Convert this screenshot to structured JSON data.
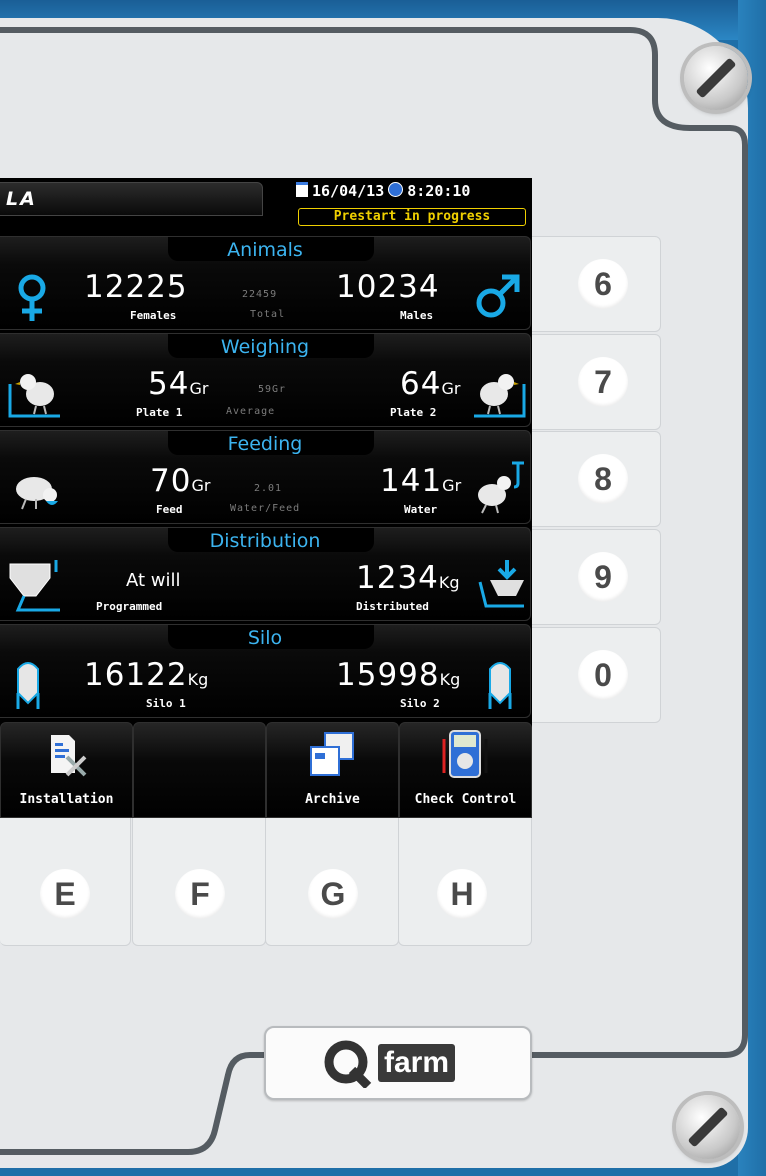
{
  "device": {
    "brand_name": "Qfarm",
    "brand_q": "Q",
    "brand_word": "farm",
    "screen_brand": "LA"
  },
  "header": {
    "date": "16/04/13",
    "time": "8:20:10",
    "status": "Prestart in progress"
  },
  "sections": {
    "animals": {
      "title": "Animals",
      "females_value": "12225",
      "females_label": "Females",
      "total_value": "22459",
      "total_label": "Total",
      "males_value": "10234",
      "males_label": "Males"
    },
    "weighing": {
      "title": "Weighing",
      "plate1_value": "54",
      "plate1_unit": "Gr",
      "plate1_label": "Plate 1",
      "average_value": "59Gr",
      "average_label": "Average",
      "plate2_value": "64",
      "plate2_unit": "Gr",
      "plate2_label": "Plate 2"
    },
    "feeding": {
      "title": "Feeding",
      "feed_value": "70",
      "feed_unit": "Gr",
      "feed_label": "Feed",
      "ratio_value": "2.01",
      "ratio_label": "Water/Feed",
      "water_value": "141",
      "water_unit": "Gr",
      "water_label": "Water"
    },
    "distribution": {
      "title": "Distribution",
      "programmed_value": "At will",
      "programmed_label": "Programmed",
      "distributed_value": "1234",
      "distributed_unit": "Kg",
      "distributed_label": "Distributed"
    },
    "silo": {
      "title": "Silo",
      "silo1_value": "16122",
      "silo1_unit": "Kg",
      "silo1_label": "Silo 1",
      "silo2_value": "15998",
      "silo2_unit": "Kg",
      "silo2_label": "Silo 2"
    }
  },
  "buttons": {
    "installation": "Installation",
    "empty": "",
    "archive": "Archive",
    "check_control": "Check Control"
  },
  "side_keys": [
    "6",
    "7",
    "8",
    "9",
    "0"
  ],
  "bottom_keys": [
    "E",
    "F",
    "G",
    "H"
  ],
  "colors": {
    "title_blue": "#3cb4f0",
    "status_yellow": "#f0d000",
    "symbol_blue": "#19a9e6"
  },
  "icons": [
    "female-symbol-icon",
    "male-symbol-icon",
    "weighing-chick-icon",
    "feeding-chicken-icon",
    "water-chick-icon",
    "feed-hopper-icon",
    "silo-icon",
    "installation-icon",
    "archive-icon",
    "multimeter-icon",
    "screw-icon",
    "calendar-icon",
    "clock-icon"
  ]
}
